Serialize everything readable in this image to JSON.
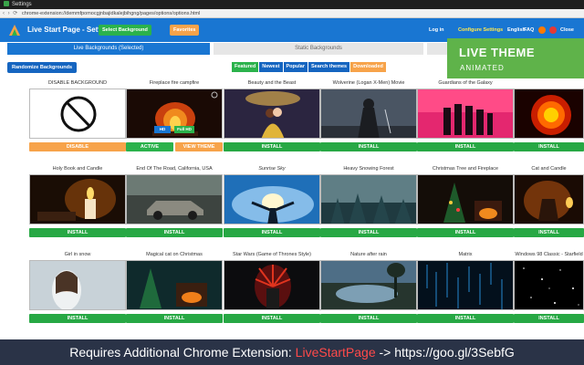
{
  "window": {
    "title": "Settings"
  },
  "browser": {
    "url": "chrome-extension://demmfpomocgjnbajidkalejbihgng/pages/options/options.html"
  },
  "header": {
    "title": "Live Start Page - Settings",
    "select_background": "Select Background",
    "favorites": "Favorites",
    "login": "Log in",
    "configure": "Configure Settings",
    "language": "English",
    "faq": "FAQ",
    "close": "Close settings"
  },
  "tabs": {
    "live": "Live Backgrounds (Selected)",
    "static": "Static Backgrounds"
  },
  "actions": {
    "randomize": "Randomize Backgrounds"
  },
  "filters": [
    "Featured",
    "Newest",
    "Popular",
    "Search themes",
    "Downloaded"
  ],
  "cards": [
    {
      "title": "DISABLE BACKGROUND",
      "button": "DISABLE",
      "thumb": "disable"
    },
    {
      "title": "Fireplace fire campfire",
      "button": "ACTIVE",
      "button2": "VIEW THEME",
      "thumb": "fire",
      "hd": "HD",
      "fullhd": "Full HD"
    },
    {
      "title": "Beauty and the Beast",
      "button": "INSTALL",
      "thumb": "beauty"
    },
    {
      "title": "Wolverine (Logan X-Men) Movie",
      "button": "INSTALL",
      "thumb": "wolverine"
    },
    {
      "title": "Guardians of the Galaxy",
      "button": "INSTALL",
      "thumb": "guardians"
    },
    {
      "title": "",
      "button": "INSTALL",
      "thumb": "sun"
    },
    {
      "title": "Holy Book and Candle",
      "button": "INSTALL",
      "thumb": "candle"
    },
    {
      "title": "End Of The Road, California, USA",
      "button": "INSTALL",
      "thumb": "car"
    },
    {
      "title": "Sunrise Sky",
      "button": "INSTALL",
      "thumb": "sunrise"
    },
    {
      "title": "Heavy Snowing Forest",
      "button": "INSTALL",
      "thumb": "forest"
    },
    {
      "title": "Christmas Tree and Fireplace",
      "button": "INSTALL",
      "thumb": "xmas"
    },
    {
      "title": "Cat and Candle",
      "button": "INSTALL",
      "thumb": "cat"
    },
    {
      "title": "Girl in snow",
      "button": "INSTALL",
      "thumb": "girl"
    },
    {
      "title": "Magical cat on Christmas",
      "button": "INSTALL",
      "thumb": "magicat"
    },
    {
      "title": "Star Wars (Game of Thrones Style)",
      "button": "INSTALL",
      "thumb": "throne"
    },
    {
      "title": "Nature after rain",
      "button": "INSTALL",
      "thumb": "nature"
    },
    {
      "title": "Matrix",
      "button": "INSTALL",
      "thumb": "matrix"
    },
    {
      "title": "Windows 98 Classic - Starfield",
      "button": "INSTALL",
      "thumb": "stars"
    }
  ],
  "overlay": {
    "ribbon_line1": "LIVE THEME",
    "ribbon_line2": "ANIMATED",
    "footer_prefix": "Requires Additional Chrome Extension: ",
    "footer_brand": "LiveStartPage",
    "footer_suffix": " -> https://goo.gl/3SebfG"
  },
  "colors": {
    "primary": "#1976d2",
    "install": "#27a844",
    "accent": "#f7a34a",
    "ribbon": "#5fb34a"
  }
}
